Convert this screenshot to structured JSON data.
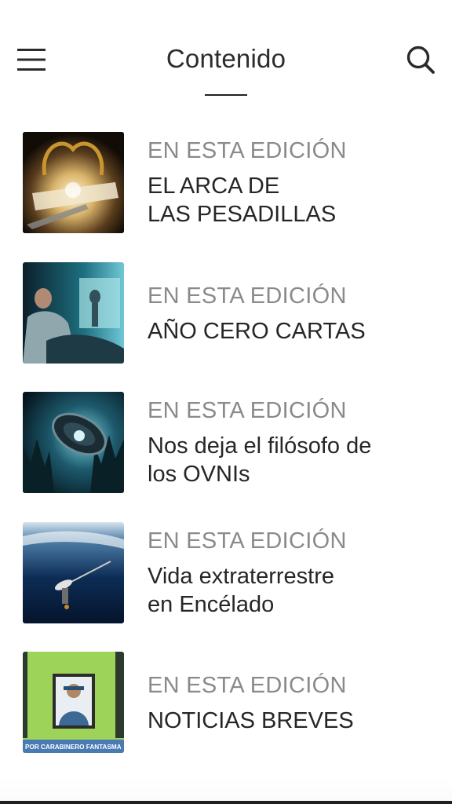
{
  "header": {
    "title": "Contenido",
    "menu_icon": "hamburger-menu-icon",
    "search_icon": "search-icon"
  },
  "articles": [
    {
      "kicker": "EN ESTA EDICIÓN",
      "headline": "EL ARCA DE\nLAS PESADILLAS",
      "thumb_icon": "ark-artwork-thumbnail"
    },
    {
      "kicker": "EN ESTA EDICIÓN",
      "headline": "AÑO CERO   CARTAS",
      "thumb_icon": "alien-visitor-thumbnail"
    },
    {
      "kicker": "EN ESTA EDICIÓN",
      "headline": "Nos deja el filósofo de\nlos OVNIs",
      "thumb_icon": "ufo-forest-thumbnail"
    },
    {
      "kicker": "EN ESTA EDICIÓN",
      "headline": "Vida extraterrestre\nen Encélado",
      "thumb_icon": "cassini-probe-thumbnail"
    },
    {
      "kicker": "EN ESTA EDICIÓN",
      "headline": "NOTICIAS BREVES",
      "thumb_icon": "carabinero-portrait-thumbnail",
      "thumb_caption": "POR CARABINERO FANTASMA"
    }
  ],
  "colors": {
    "title": "#2c2c2c",
    "kicker": "#8a8a8a",
    "headline": "#262626",
    "background": "#ffffff"
  }
}
